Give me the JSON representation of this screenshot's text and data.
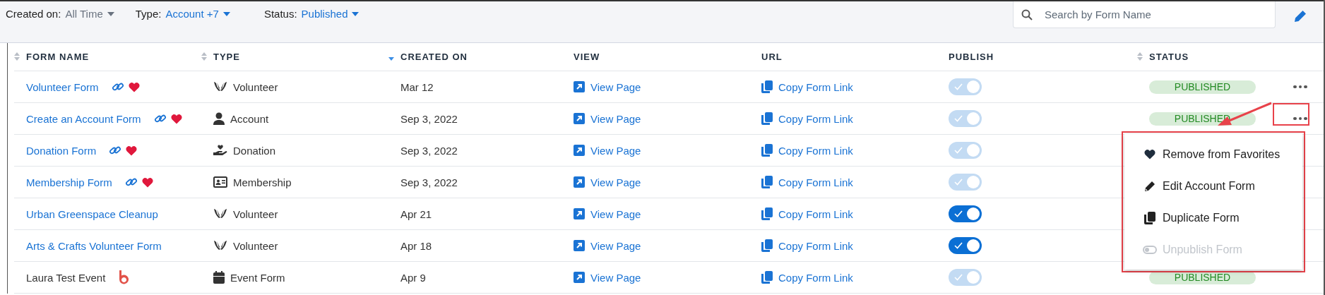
{
  "filters": [
    {
      "label": "Created on:",
      "value": "All Time",
      "accent": false
    },
    {
      "label": "Type:",
      "value": "Account +7",
      "accent": true
    },
    {
      "label": "Status:",
      "value": "Published",
      "accent": true
    }
  ],
  "search": {
    "placeholder": "Search by Form Name"
  },
  "columns": [
    {
      "label": "FORM NAME",
      "sortable": true,
      "sorted": false
    },
    {
      "label": "TYPE",
      "sortable": true,
      "sorted": false
    },
    {
      "label": "CREATED ON",
      "sortable": true,
      "sorted": true
    },
    {
      "label": "VIEW",
      "sortable": false,
      "sorted": false
    },
    {
      "label": "URL",
      "sortable": false,
      "sorted": false
    },
    {
      "label": "PUBLISH",
      "sortable": false,
      "sorted": false
    },
    {
      "label": "STATUS",
      "sortable": true,
      "sorted": false
    }
  ],
  "rows": [
    {
      "name": {
        "text": "Volunteer Form",
        "linked": true
      },
      "name_icons": [
        {
          "kind": "link"
        },
        {
          "kind": "heart"
        }
      ],
      "type": {
        "kind": "volunteer",
        "label": "Volunteer"
      },
      "created": "Mar 12",
      "view": "View Page",
      "url": "Copy Form Link",
      "publish": {
        "on": true,
        "disabled": true
      },
      "status": "PUBLISHED",
      "more": true
    },
    {
      "name": {
        "text": "Create an Account Form",
        "linked": true
      },
      "name_icons": [
        {
          "kind": "link"
        },
        {
          "kind": "heart"
        }
      ],
      "type": {
        "kind": "account",
        "label": "Account"
      },
      "created": "Sep 3, 2022",
      "view": "View Page",
      "url": "Copy Form Link",
      "publish": {
        "on": true,
        "disabled": true
      },
      "status": "PUBLISHED",
      "more": true
    },
    {
      "name": {
        "text": "Donation Form",
        "linked": true
      },
      "name_icons": [
        {
          "kind": "link"
        },
        {
          "kind": "heart"
        }
      ],
      "type": {
        "kind": "donation",
        "label": "Donation"
      },
      "created": "Sep 3, 2022",
      "view": "View Page",
      "url": "Copy Form Link",
      "publish": {
        "on": true,
        "disabled": true
      },
      "more": false
    },
    {
      "name": {
        "text": "Membership Form",
        "linked": true
      },
      "name_icons": [
        {
          "kind": "link"
        },
        {
          "kind": "heart"
        }
      ],
      "type": {
        "kind": "membership",
        "label": "Membership"
      },
      "created": "Sep 3, 2022",
      "view": "View Page",
      "url": "Copy Form Link",
      "publish": {
        "on": true,
        "disabled": true
      },
      "more": false
    },
    {
      "name": {
        "text": "Urban Greenspace Cleanup",
        "linked": true
      },
      "name_icons": [],
      "type": {
        "kind": "volunteer",
        "label": "Volunteer"
      },
      "created": "Apr 21",
      "view": "View Page",
      "url": "Copy Form Link",
      "publish": {
        "on": true,
        "disabled": false
      },
      "more": false
    },
    {
      "name": {
        "text": "Arts & Crafts Volunteer Form",
        "linked": true
      },
      "name_icons": [],
      "type": {
        "kind": "volunteer",
        "label": "Volunteer"
      },
      "created": "Apr 18",
      "view": "View Page",
      "url": "Copy Form Link",
      "publish": {
        "on": true,
        "disabled": false
      },
      "more": false
    },
    {
      "name": {
        "text": "Laura Test Event",
        "linked": false
      },
      "name_icons": [
        {
          "kind": "logo"
        }
      ],
      "type": {
        "kind": "event",
        "label": "Event Form"
      },
      "created": "Apr 9",
      "view": "View Page",
      "url": "Copy Form Link",
      "publish": {
        "on": true,
        "disabled": true
      },
      "status": "PUBLISHED",
      "more": false
    }
  ],
  "menu": {
    "items": [
      {
        "kind": "heart",
        "label": "Remove from Favorites",
        "disabled": false
      },
      {
        "kind": "edit",
        "label": "Edit Account Form",
        "disabled": false
      },
      {
        "kind": "copy",
        "label": "Duplicate Form",
        "disabled": false
      },
      {
        "kind": "toggle",
        "label": "Unpublish Form",
        "disabled": true
      }
    ]
  },
  "annotations": [
    {
      "kind": "more_box"
    },
    {
      "kind": "menu_box"
    },
    {
      "kind": "arrow"
    }
  ]
}
